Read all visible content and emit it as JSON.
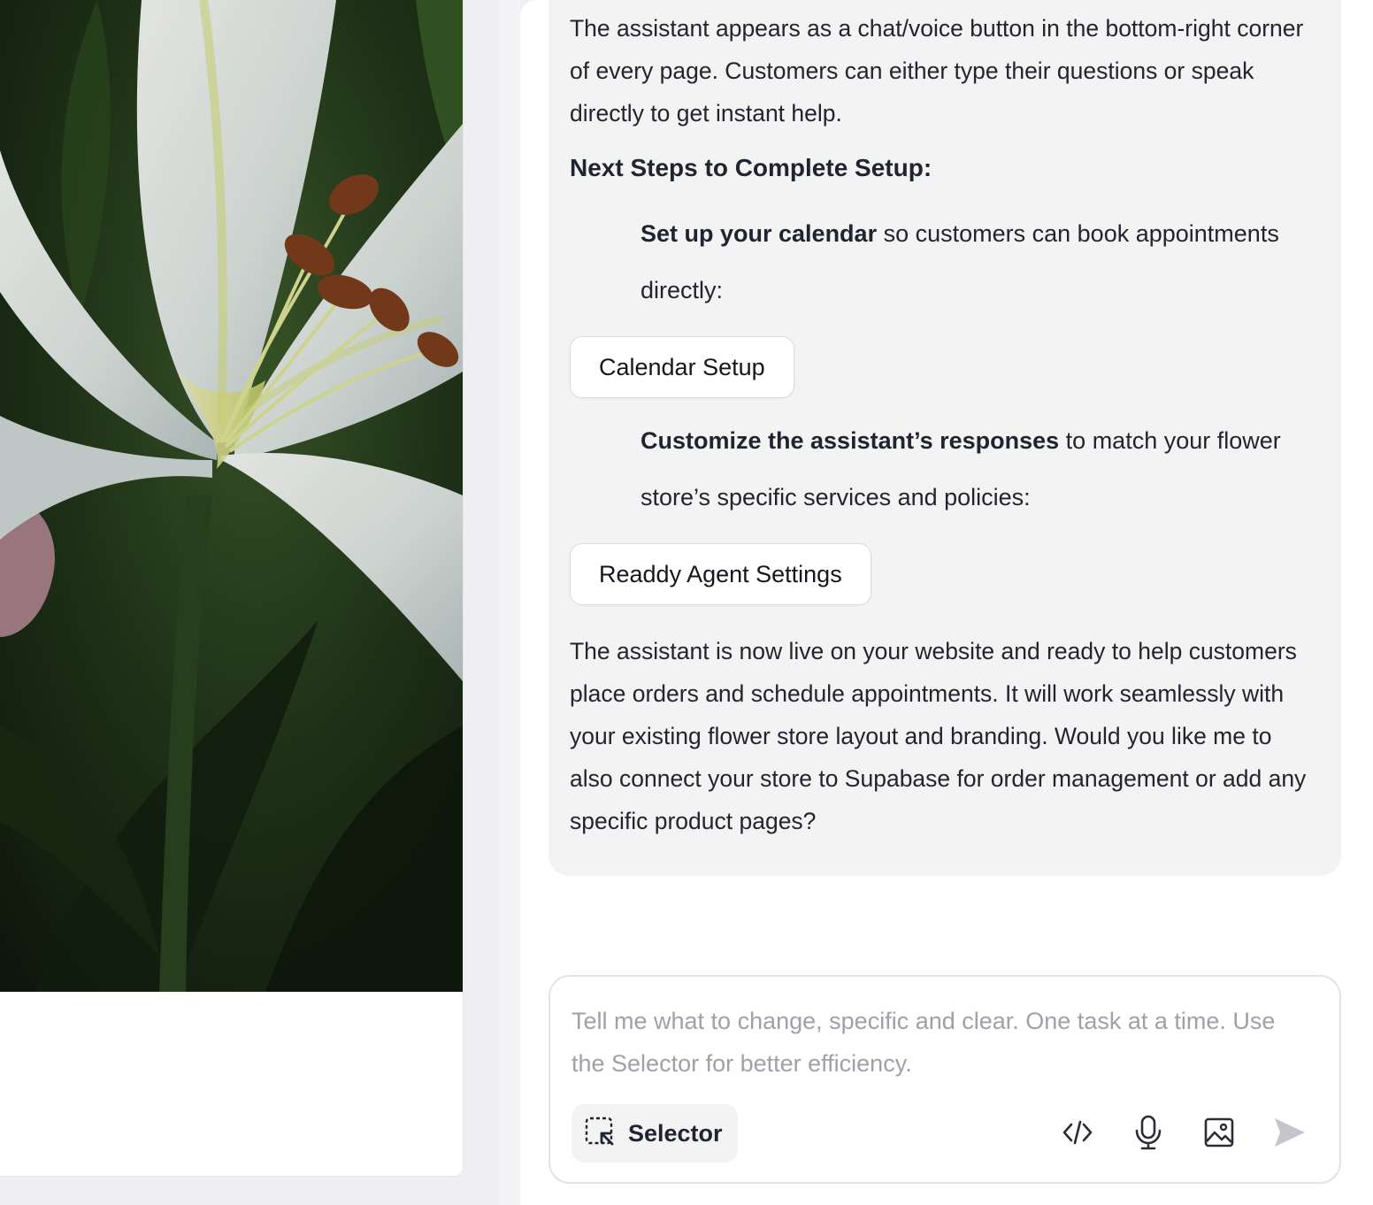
{
  "preview": {
    "hero_alt": "white lily flower"
  },
  "chat": {
    "intro_text": "The assistant appears as a chat/voice button in the bottom-right corner of every page. Customers can either type their questions or speak directly to get instant help.",
    "next_steps_heading": "Next Steps to Complete Setup:",
    "steps": [
      {
        "bold": "Set up your calendar",
        "rest": " so customers can book appointments directly:",
        "button_label": "Calendar Setup"
      },
      {
        "bold": "Customize the assistant’s responses",
        "rest": " to match your flower store’s specific services and policies:",
        "button_label": "Readdy Agent Settings"
      }
    ],
    "closing_text": "The assistant is now live on your website and ready to help customers place orders and schedule appointments. It will work seamlessly with your existing flower store layout and branding. Would you like me to also connect your store to Supabase for order management or add any specific product pages?"
  },
  "composer": {
    "placeholder": "Tell me what to change, specific and clear. One task at a time. Use the Selector for better efficiency.",
    "value": "",
    "selector_label": "Selector",
    "icons": [
      "selector-icon",
      "code-icon",
      "microphone-icon",
      "image-icon",
      "send-icon"
    ]
  },
  "colors": {
    "bubble_bg": "#f3f3f4",
    "placeholder": "#9ea1a8",
    "send_disabled": "#c4c6cc"
  }
}
